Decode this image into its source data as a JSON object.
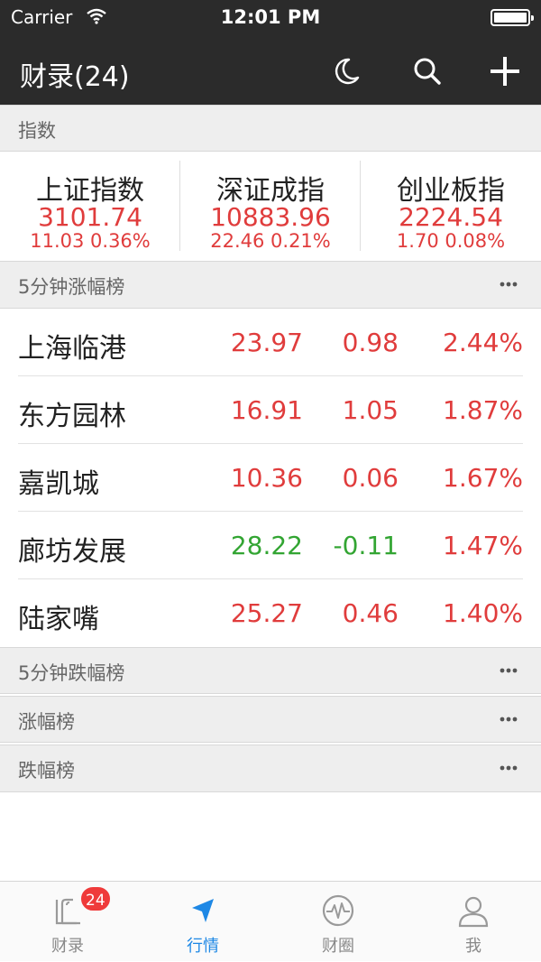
{
  "status_bar": {
    "carrier": "Carrier",
    "time": "12:01 PM",
    "battery_level": 1.0
  },
  "nav": {
    "title": "财录(24)"
  },
  "sections": {
    "index": "指数",
    "gainers_5min": "5分钟涨幅榜",
    "losers_5min": "5分钟跌幅榜",
    "gainers": "涨幅榜",
    "losers": "跌幅榜"
  },
  "indices": [
    {
      "name": "上证指数",
      "value": "3101.74",
      "change": "11.03 0.36%"
    },
    {
      "name": "深证成指",
      "value": "10883.96",
      "change": "22.46 0.21%"
    },
    {
      "name": "创业板指",
      "value": "2224.54",
      "change": "1.70 0.08%"
    }
  ],
  "stocks": [
    {
      "name": "上海临港",
      "price": "23.97",
      "delta": "0.98",
      "pct": "2.44%",
      "trend": "up"
    },
    {
      "name": "东方园林",
      "price": "16.91",
      "delta": "1.05",
      "pct": "1.87%",
      "trend": "up"
    },
    {
      "name": "嘉凯城",
      "price": "10.36",
      "delta": "0.06",
      "pct": "1.67%",
      "trend": "up"
    },
    {
      "name": "廊坊发展",
      "price": "28.22",
      "delta": "-0.11",
      "pct": "1.47%",
      "trend": "down"
    },
    {
      "name": "陆家嘴",
      "price": "25.27",
      "delta": "0.46",
      "pct": "1.40%",
      "trend": "up"
    }
  ],
  "tabs": [
    {
      "label": "财录",
      "icon": "news-icon",
      "badge": "24"
    },
    {
      "label": "行情",
      "icon": "location-arrow-icon"
    },
    {
      "label": "财圈",
      "icon": "pulse-icon"
    },
    {
      "label": "我",
      "icon": "user-icon"
    }
  ],
  "colors": {
    "bar_bg": "#2b2b2b",
    "up": "#e03c3c",
    "down": "#33a533",
    "active_tab": "#1e88e5",
    "badge": "#ef3a3a"
  }
}
